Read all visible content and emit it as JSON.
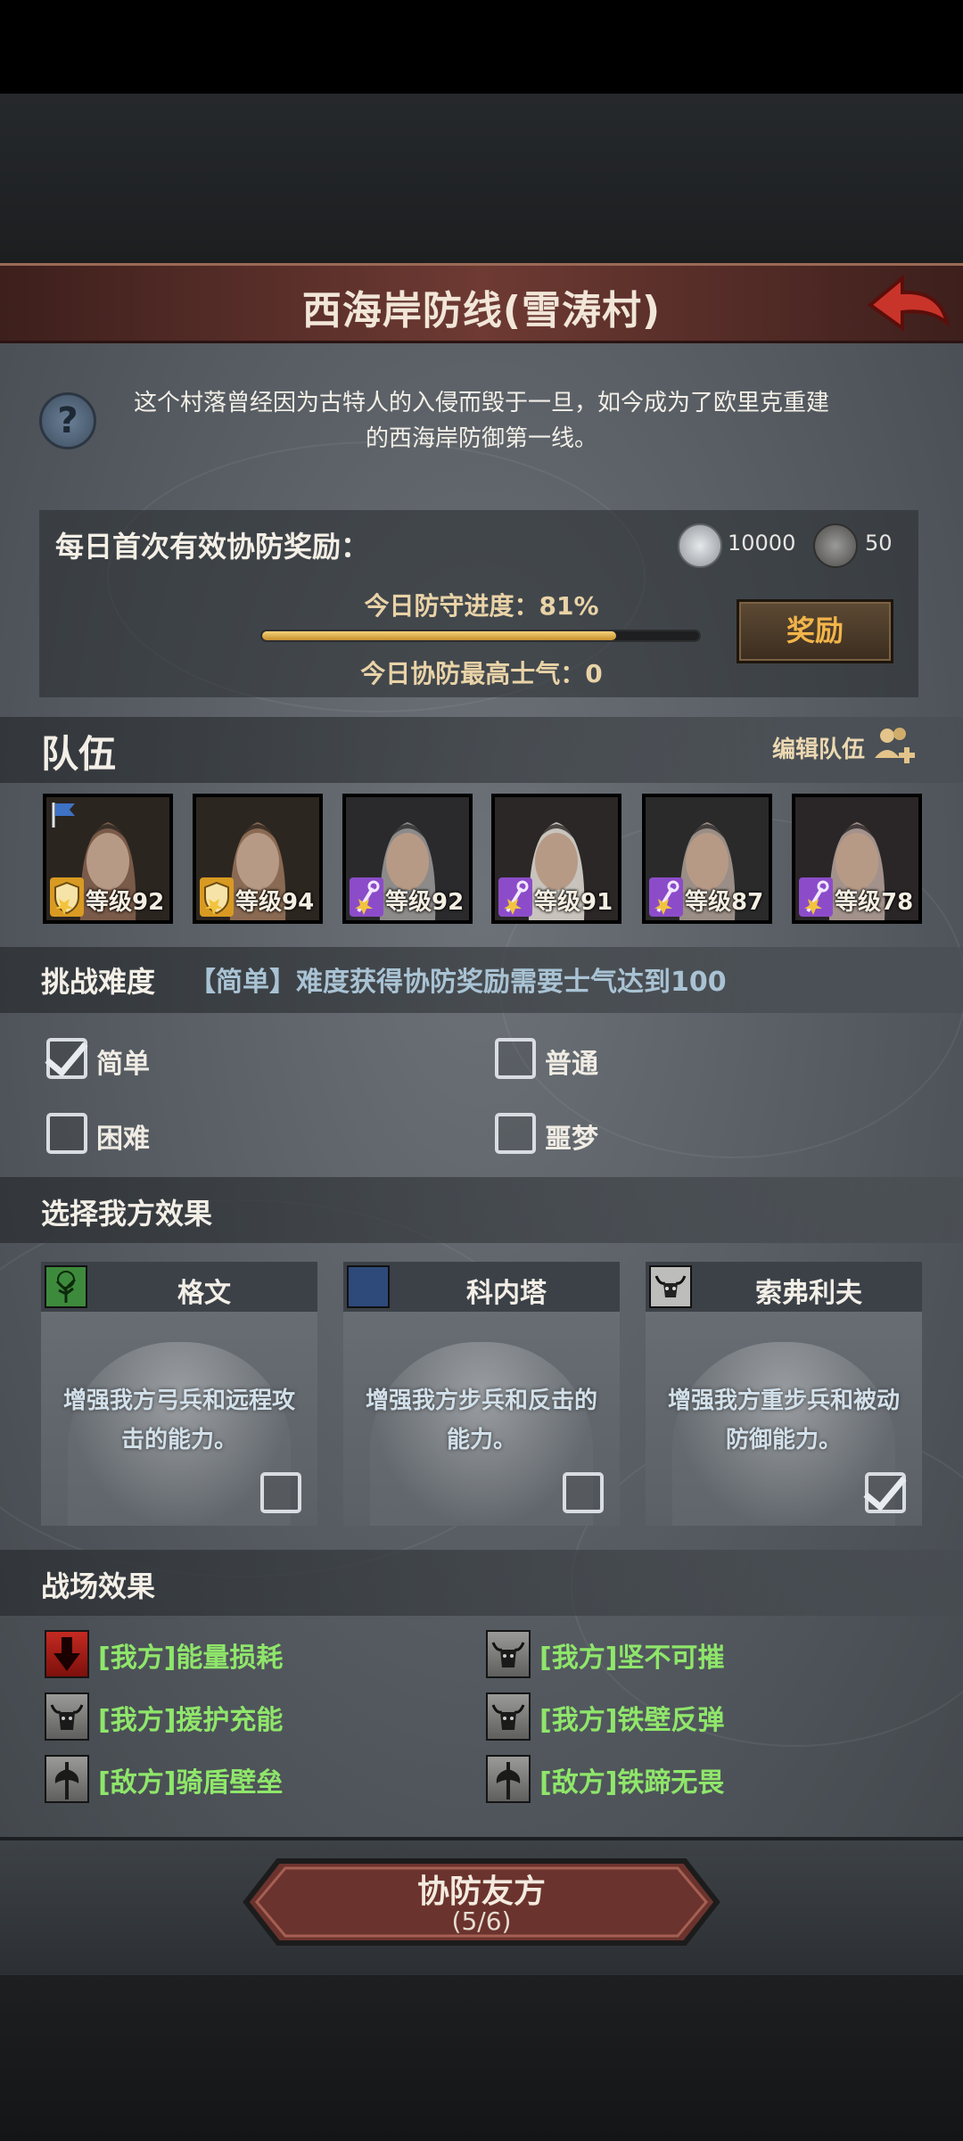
{
  "header": {
    "title": "西海岸防线(雪涛村)"
  },
  "info": {
    "description_line1": "这个村落曾经因为古特人的入侵而毁于一旦，如今成为了欧里克重建",
    "description_line2": "的西海岸防御第一线。"
  },
  "daily_reward": {
    "title": "每日首次有效协防奖励：",
    "coin_silver": "10000",
    "coin_dark": "50",
    "progress_label": "今日防守进度：",
    "progress_value": "81%",
    "progress_fraction": 0.81,
    "morale_label": "今日协防最高士气：",
    "morale_value": "0",
    "reward_button": "奖励"
  },
  "team": {
    "title": "队伍",
    "edit_label": "编辑队伍",
    "heroes": [
      {
        "level": "等级92",
        "badge": "shield",
        "leader": true
      },
      {
        "level": "等级94",
        "badge": "shield",
        "leader": false
      },
      {
        "level": "等级92",
        "badge": "staff",
        "leader": false
      },
      {
        "level": "等级91",
        "badge": "staff",
        "leader": false
      },
      {
        "level": "等级87",
        "badge": "staff",
        "leader": false
      },
      {
        "level": "等级78",
        "badge": "staff",
        "leader": false
      }
    ]
  },
  "difficulty": {
    "title": "挑战难度",
    "note": "【简单】难度获得协防奖励需要士气达到100",
    "options": [
      {
        "label": "简单",
        "checked": true
      },
      {
        "label": "普通",
        "checked": false
      },
      {
        "label": "困难",
        "checked": false
      },
      {
        "label": "噩梦",
        "checked": false
      }
    ]
  },
  "our_effects": {
    "title": "选择我方效果",
    "cards": [
      {
        "name": "格文",
        "icon": "tree-icon",
        "desc_line1": "增强我方弓兵和远程攻",
        "desc_line2": "击的能力。",
        "checked": false
      },
      {
        "name": "科内塔",
        "icon": "moon-icon",
        "desc_line1": "增强我方步兵和反击的",
        "desc_line2": "能力。",
        "checked": false
      },
      {
        "name": "索弗利夫",
        "icon": "bull-skull-icon",
        "desc_line1": "增强我方重步兵和被动",
        "desc_line2": "防御能力。",
        "checked": true
      }
    ]
  },
  "battlefield": {
    "title": "战场效果",
    "items": [
      {
        "label": "[我方]能量损耗",
        "icon": "red-arrow-down-icon"
      },
      {
        "label": "[我方]坚不可摧",
        "icon": "bull-skull-icon"
      },
      {
        "label": "[我方]援护充能",
        "icon": "bull-skull-icon"
      },
      {
        "label": "[我方]铁壁反弹",
        "icon": "bull-skull-icon"
      },
      {
        "label": "[敌方]骑盾壁垒",
        "icon": "axe-icon"
      },
      {
        "label": "[敌方]铁蹄无畏",
        "icon": "axe-icon"
      }
    ]
  },
  "bottom": {
    "button_label": "协防友方",
    "button_count": "(5/6)"
  }
}
